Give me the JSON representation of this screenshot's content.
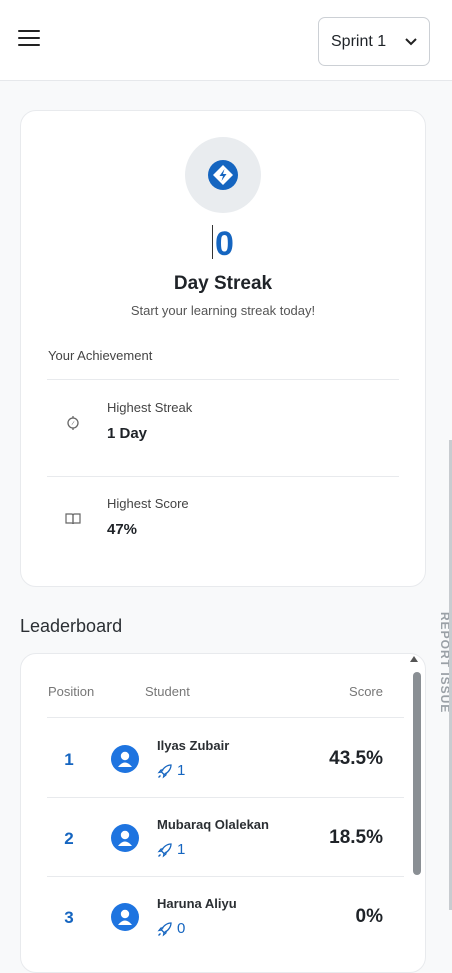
{
  "header": {
    "sprint_select": {
      "value": "Sprint 1"
    }
  },
  "streak": {
    "count": "0",
    "title": "Day Streak",
    "subtitle": "Start your learning streak today!"
  },
  "achievement": {
    "label": "Your Achievement",
    "items": [
      {
        "title": "Highest Streak",
        "value": "1 Day",
        "icon": "compass-icon"
      },
      {
        "title": "Highest Score",
        "value": "47%",
        "icon": "book-icon"
      }
    ]
  },
  "leaderboard": {
    "heading": "Leaderboard",
    "columns": {
      "position": "Position",
      "student": "Student",
      "score": "Score"
    },
    "rows": [
      {
        "position": "1",
        "name": "Ilyas Zubair",
        "streak": "1",
        "score": "43.5%"
      },
      {
        "position": "2",
        "name": "Mubaraq Olalekan",
        "streak": "1",
        "score": "18.5%"
      },
      {
        "position": "3",
        "name": "Haruna Aliyu",
        "streak": "0",
        "score": "0%"
      }
    ]
  },
  "report_issue": "REPORT ISSUE",
  "colors": {
    "accent": "#1565c0",
    "background": "#f8f9fa"
  }
}
